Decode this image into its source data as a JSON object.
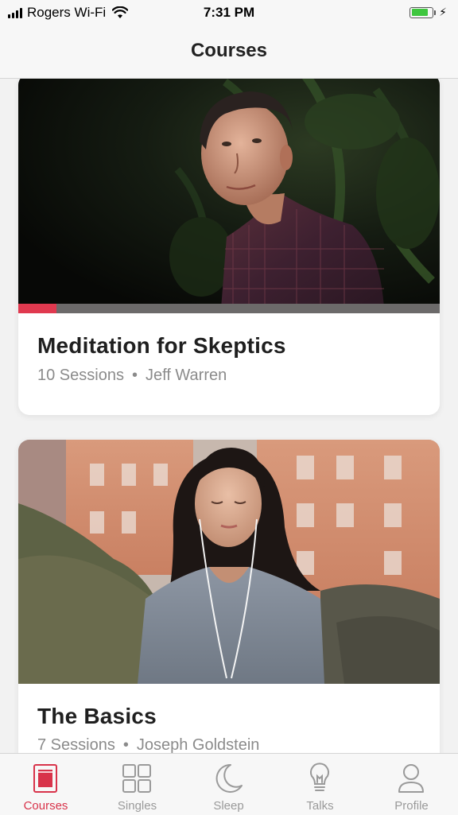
{
  "status_bar": {
    "carrier": "Rogers Wi-Fi",
    "time": "7:31 PM",
    "battery_level": 0.85
  },
  "nav": {
    "title": "Courses"
  },
  "courses": [
    {
      "title": "Meditation for Skeptics",
      "sessions": "10 Sessions",
      "separator": "•",
      "author": "Jeff Warren",
      "progress": 0.09
    },
    {
      "title": "The Basics",
      "sessions": "7 Sessions",
      "separator": "•",
      "author": "Joseph Goldstein"
    }
  ],
  "tabs": [
    {
      "label": "Courses",
      "icon": "courses-icon",
      "active": true
    },
    {
      "label": "Singles",
      "icon": "singles-grid-icon",
      "active": false
    },
    {
      "label": "Sleep",
      "icon": "moon-icon",
      "active": false
    },
    {
      "label": "Talks",
      "icon": "lightbulb-icon",
      "active": false
    },
    {
      "label": "Profile",
      "icon": "person-icon",
      "active": false
    }
  ],
  "colors": {
    "accent": "#d8334a",
    "progress": "#e0394f",
    "inactive_tab": "#9a9a9a",
    "battery": "#3ec63e"
  }
}
